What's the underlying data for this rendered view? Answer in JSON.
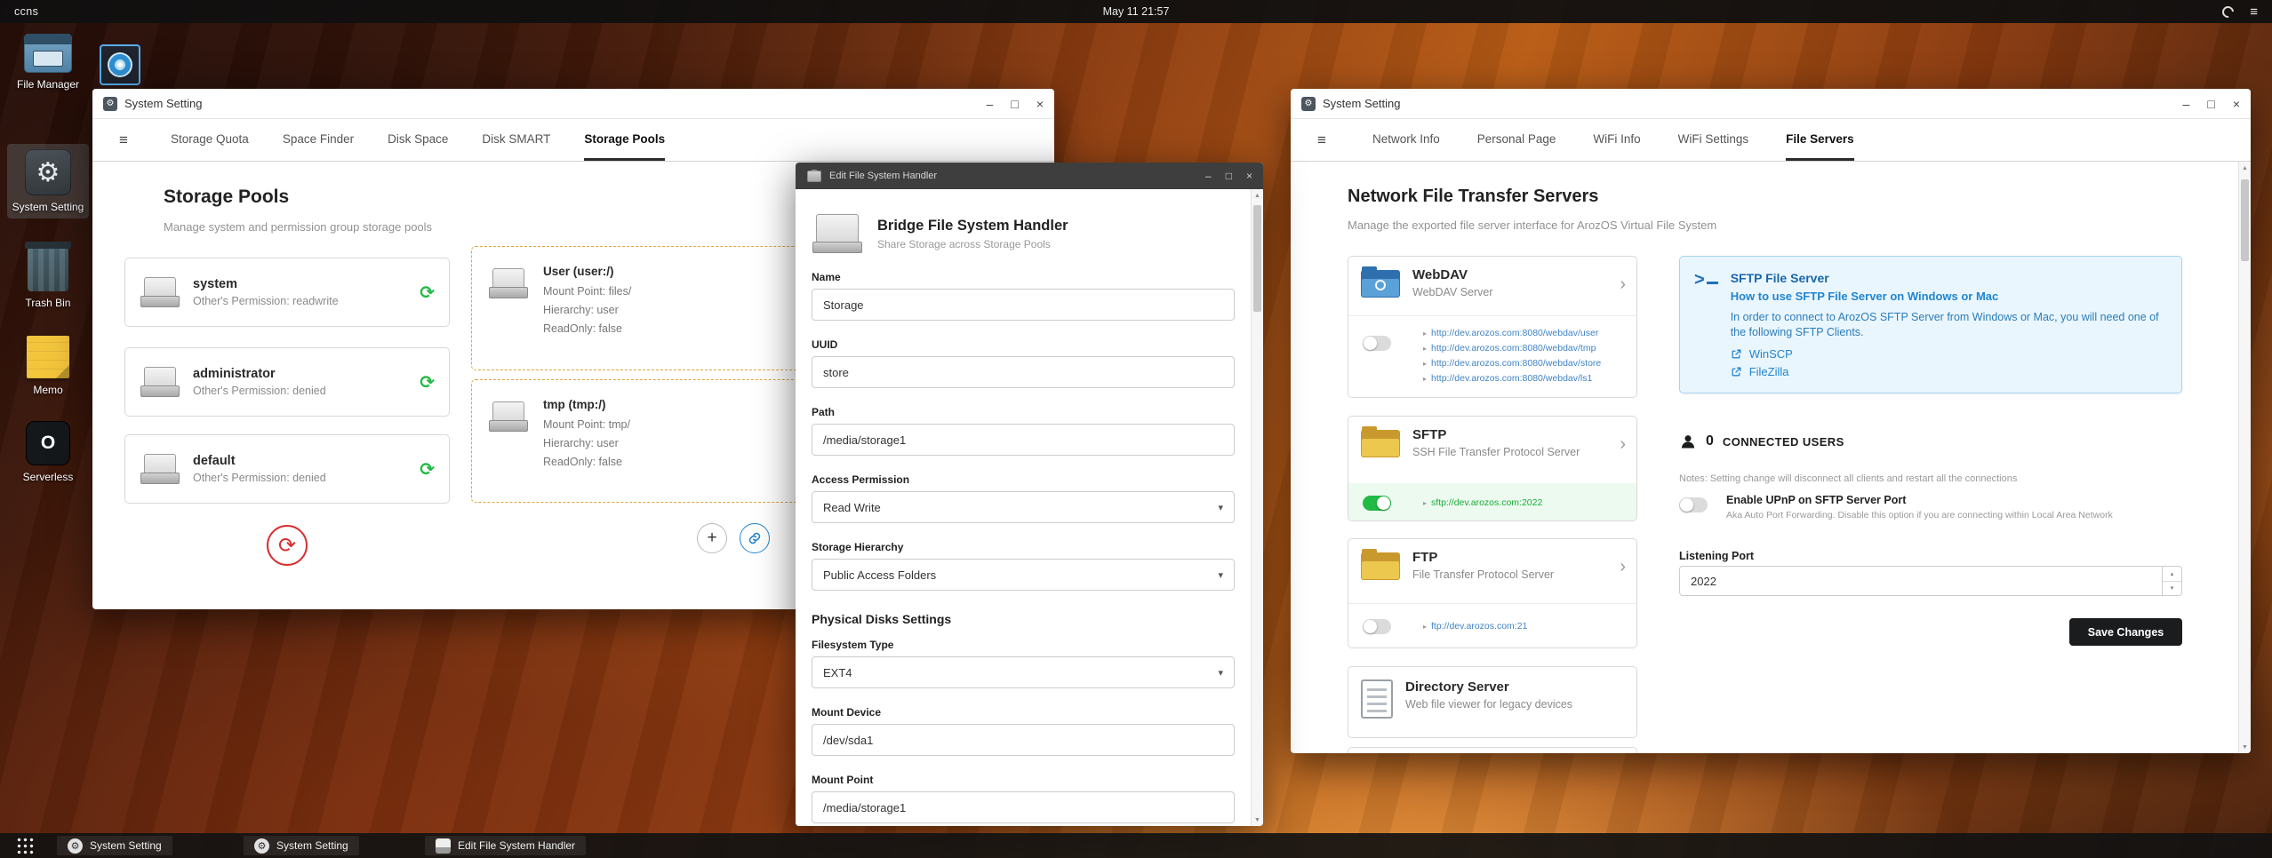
{
  "topbar": {
    "host": "ccns",
    "clock": "May 11 21:57"
  },
  "icons": {
    "gear": "⚙",
    "menu": "≡",
    "minimize": "–",
    "maximize": "□",
    "close": "×",
    "chevron_right": "›",
    "caret_down": "▾",
    "bullet": "▸",
    "sync": "⟳",
    "arrow_up": "▲",
    "arrow_down": "▼",
    "step_up": "▴",
    "step_down": "▾",
    "plus": "+",
    "serverless": "O"
  },
  "colors": {
    "green": "#21ba45",
    "red": "#db2828",
    "blue": "#2185d0",
    "link": "#4183c4",
    "dark_button": "#1b1c1d"
  },
  "desktop": {
    "icons": [
      {
        "label": "File Manager"
      },
      {
        "label": "System Setting"
      },
      {
        "label": "Trash Bin"
      },
      {
        "label": "Memo"
      },
      {
        "label": "Serverless"
      }
    ]
  },
  "left_window": {
    "title": "System Setting",
    "tabs": [
      "Storage Quota",
      "Space Finder",
      "Disk Space",
      "Disk SMART",
      "Storage Pools"
    ],
    "heading": "Storage Pools",
    "subtitle": "Manage system and permission group storage pools",
    "pools": [
      {
        "name": "system",
        "desc": "Other's Permission: readwrite"
      },
      {
        "name": "administrator",
        "desc": "Other's Permission: denied"
      },
      {
        "name": "default",
        "desc": "Other's Permission: denied"
      }
    ],
    "mounts": [
      {
        "name": "User (user:/)",
        "line1": "Mount Point: files/",
        "line2": "Hierarchy: user",
        "line3": "ReadOnly: false"
      },
      {
        "name": "tmp (tmp:/)",
        "line1": "Mount Point: tmp/",
        "line2": "Hierarchy: user",
        "line3": "ReadOnly: false"
      }
    ]
  },
  "editor_window": {
    "title": "Edit File System Handler",
    "heading": "Bridge File System Handler",
    "subheading": "Share Storage across Storage Pools",
    "section": "Physical Disks Settings",
    "fields": {
      "name": {
        "label": "Name",
        "value": "Storage"
      },
      "uuid": {
        "label": "UUID",
        "value": "store"
      },
      "path": {
        "label": "Path",
        "value": "/media/storage1"
      },
      "access": {
        "label": "Access Permission",
        "value": "Read Write"
      },
      "hierarchy": {
        "label": "Storage Hierarchy",
        "value": "Public Access Folders"
      },
      "fstype": {
        "label": "Filesystem Type",
        "value": "EXT4"
      },
      "mount_device": {
        "label": "Mount Device",
        "value": "/dev/sda1"
      },
      "mount_point": {
        "label": "Mount Point",
        "value": "/media/storage1"
      }
    }
  },
  "right_window": {
    "title": "System Setting",
    "tabs": [
      "Network Info",
      "Personal Page",
      "WiFi Info",
      "WiFi Settings",
      "File Servers"
    ],
    "heading": "Network File Transfer Servers",
    "subtitle": "Manage the exported file server interface for ArozOS Virtual File System",
    "servers": [
      {
        "name": "WebDAV",
        "desc": "WebDAV Server",
        "links": [
          "http://dev.arozos.com:8080/webdav/user",
          "http://dev.arozos.com:8080/webdav/tmp",
          "http://dev.arozos.com:8080/webdav/store",
          "http://dev.arozos.com:8080/webdav/ls1"
        ]
      },
      {
        "name": "SFTP",
        "desc": "SSH File Transfer Protocol Server",
        "links": [
          "sftp://dev.arozos.com:2022"
        ]
      },
      {
        "name": "FTP",
        "desc": "File Transfer Protocol Server",
        "links": [
          "ftp://dev.arozos.com:21"
        ]
      },
      {
        "name": "Directory Server",
        "desc": "Web file viewer for legacy devices"
      }
    ],
    "sftp_info": {
      "title": "SFTP File Server",
      "subtitle": "How to use SFTP File Server on Windows or Mac",
      "body": "In order to connect to ArozOS SFTP Server from Windows or Mac, you will need one of the following SFTP Clients.",
      "clients": [
        "WinSCP",
        "FileZilla"
      ]
    },
    "connected": {
      "count": "0",
      "label": "CONNECTED USERS",
      "notes": "Notes: Setting change will disconnect all clients and restart all the connections"
    },
    "upnp": {
      "label": "Enable UPnP on SFTP Server Port",
      "sub": "Aka Auto Port Forwarding. Disable this option if you are connecting within Local Area Network"
    },
    "port": {
      "label": "Listening Port",
      "value": "2022"
    },
    "save_label": "Save Changes"
  },
  "taskbar": {
    "items": [
      {
        "label": "System Setting"
      },
      {
        "label": "System Setting"
      },
      {
        "label": "Edit File System Handler"
      }
    ]
  }
}
